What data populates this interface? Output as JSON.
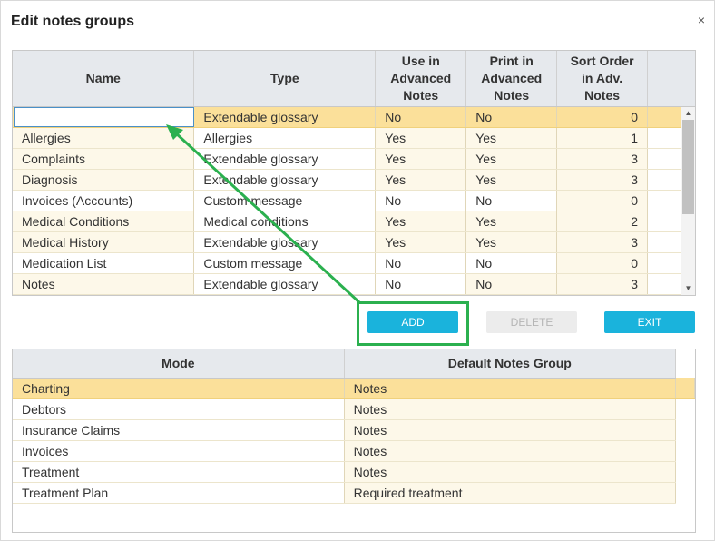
{
  "dialog": {
    "title": "Edit notes groups",
    "close_glyph": "×"
  },
  "notes_grid": {
    "headers": {
      "name": "Name",
      "type": "Type",
      "use_adv": [
        "Use in",
        "Advanced",
        "Notes"
      ],
      "print_adv": [
        "Print in",
        "Advanced",
        "Notes"
      ],
      "sort": [
        "Sort Order",
        "in Adv.",
        "Notes"
      ]
    },
    "rows": [
      {
        "name": "",
        "type": "Extendable glossary",
        "use": "No",
        "print": "No",
        "sort": "0"
      },
      {
        "name": "Allergies",
        "type": "Allergies",
        "use": "Yes",
        "print": "Yes",
        "sort": "1"
      },
      {
        "name": "Complaints",
        "type": "Extendable glossary",
        "use": "Yes",
        "print": "Yes",
        "sort": "3"
      },
      {
        "name": "Diagnosis",
        "type": "Extendable glossary",
        "use": "Yes",
        "print": "Yes",
        "sort": "3"
      },
      {
        "name": "Invoices (Accounts)",
        "type": "Custom message",
        "use": "No",
        "print": "No",
        "sort": "0"
      },
      {
        "name": "Medical Conditions",
        "type": "Medical conditions",
        "use": "Yes",
        "print": "Yes",
        "sort": "2"
      },
      {
        "name": "Medical History",
        "type": "Extendable glossary",
        "use": "Yes",
        "print": "Yes",
        "sort": "3"
      },
      {
        "name": "Medication List",
        "type": "Custom message",
        "use": "No",
        "print": "No",
        "sort": "0"
      },
      {
        "name": "Notes",
        "type": "Extendable glossary",
        "use": "No",
        "print": "No",
        "sort": "3"
      }
    ]
  },
  "buttons": {
    "add": "ADD",
    "delete": "DELETE",
    "exit": "EXIT"
  },
  "mode_grid": {
    "headers": {
      "mode": "Mode",
      "default_group": "Default Notes Group"
    },
    "rows": [
      {
        "mode": "Charting",
        "group": "Notes"
      },
      {
        "mode": "Debtors",
        "group": "Notes"
      },
      {
        "mode": "Insurance Claims",
        "group": "Notes"
      },
      {
        "mode": "Invoices",
        "group": "Notes"
      },
      {
        "mode": "Treatment",
        "group": "Notes"
      },
      {
        "mode": "Treatment Plan",
        "group": "Required treatment"
      }
    ]
  },
  "colors": {
    "accent": "#1ab3dc",
    "selected_row": "#fbe09a",
    "row_alt": "#fdf8e9",
    "annotation_green": "#2bb04f"
  },
  "icons": {
    "scroll_up": "scroll-up-arrow-icon",
    "scroll_down": "scroll-down-arrow-icon",
    "close": "close-icon"
  }
}
